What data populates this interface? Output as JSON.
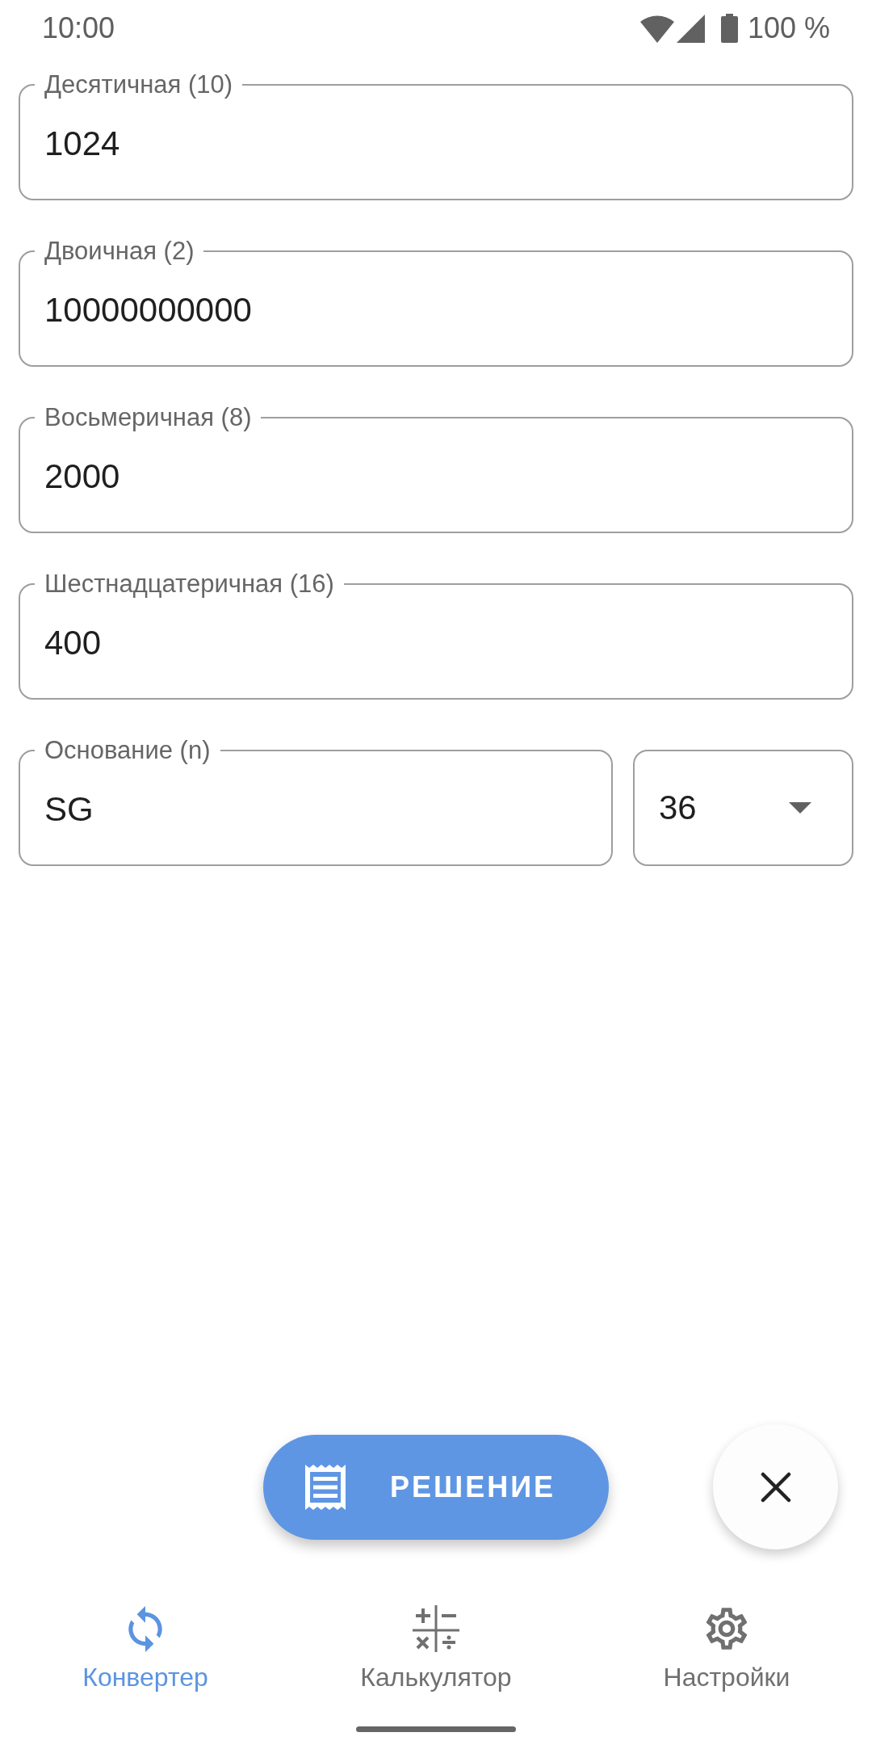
{
  "status_bar": {
    "time": "10:00",
    "battery": "100 %"
  },
  "fields": [
    {
      "label": "Десятичная (10)",
      "value": "1024"
    },
    {
      "label": "Двоичная (2)",
      "value": "10000000000"
    },
    {
      "label": "Восьмеричная (8)",
      "value": "2000"
    },
    {
      "label": "Шестнадцатеричная (16)",
      "value": "400"
    }
  ],
  "custom_base": {
    "label": "Основание (n)",
    "value": "SG",
    "base": "36"
  },
  "solution_button": {
    "label": "РЕШЕНИЕ"
  },
  "bottom_nav": [
    {
      "label": "Конвертер",
      "selected": true
    },
    {
      "label": "Калькулятор",
      "selected": false
    },
    {
      "label": "Настройки",
      "selected": false
    }
  ]
}
